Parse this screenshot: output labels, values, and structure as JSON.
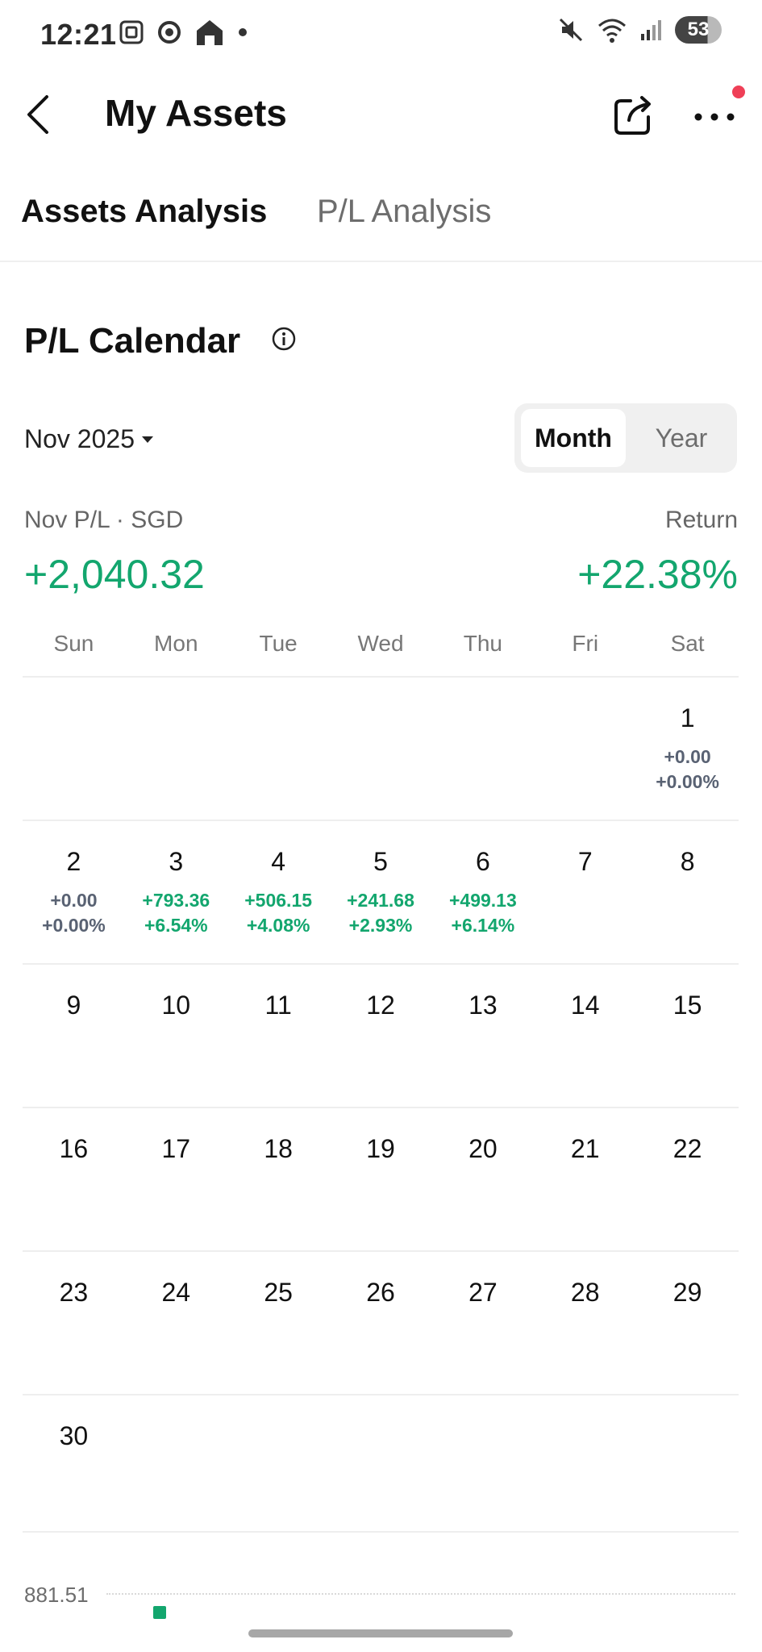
{
  "status_bar": {
    "time": "12:21",
    "battery": "53",
    "icons": [
      "scan-icon",
      "chrome-icon",
      "home-app-icon",
      "dot-icon",
      "mute-icon",
      "wifi-icon",
      "signal-icon",
      "battery-icon"
    ]
  },
  "header": {
    "title": "My Assets",
    "icons": [
      "back-arrow-icon",
      "share-icon",
      "more-icon"
    ],
    "notification_dot_color": "#ef3f57"
  },
  "tabs": [
    {
      "label": "Assets Analysis",
      "active": true
    },
    {
      "label": "P/L Analysis",
      "active": false
    }
  ],
  "section": {
    "title": "P/L Calendar",
    "info_icon": "info-icon"
  },
  "controls": {
    "month_label": "Nov 2025",
    "toggle": {
      "month": "Month",
      "year": "Year",
      "selected": "Month"
    }
  },
  "summary": {
    "pl_label": "Nov P/L · SGD",
    "pl_value": "+2,040.32",
    "return_label": "Return",
    "return_value": "+22.38%",
    "accent_color": "#13a66e"
  },
  "calendar": {
    "weekdays": [
      "Sun",
      "Mon",
      "Tue",
      "Wed",
      "Thu",
      "Fri",
      "Sat"
    ],
    "weeks": [
      [
        {
          "day": ""
        },
        {
          "day": ""
        },
        {
          "day": ""
        },
        {
          "day": ""
        },
        {
          "day": ""
        },
        {
          "day": ""
        },
        {
          "day": "1",
          "pl": "+0.00",
          "ret": "+0.00%",
          "tone": "neutral"
        }
      ],
      [
        {
          "day": "2",
          "pl": "+0.00",
          "ret": "+0.00%",
          "tone": "neutral"
        },
        {
          "day": "3",
          "pl": "+793.36",
          "ret": "+6.54%",
          "tone": "pos"
        },
        {
          "day": "4",
          "pl": "+506.15",
          "ret": "+4.08%",
          "tone": "pos"
        },
        {
          "day": "5",
          "pl": "+241.68",
          "ret": "+2.93%",
          "tone": "pos"
        },
        {
          "day": "6",
          "pl": "+499.13",
          "ret": "+6.14%",
          "tone": "pos"
        },
        {
          "day": "7"
        },
        {
          "day": "8"
        }
      ],
      [
        {
          "day": "9"
        },
        {
          "day": "10"
        },
        {
          "day": "11"
        },
        {
          "day": "12"
        },
        {
          "day": "13"
        },
        {
          "day": "14"
        },
        {
          "day": "15"
        }
      ],
      [
        {
          "day": "16"
        },
        {
          "day": "17"
        },
        {
          "day": "18"
        },
        {
          "day": "19"
        },
        {
          "day": "20"
        },
        {
          "day": "21"
        },
        {
          "day": "22"
        }
      ],
      [
        {
          "day": "23"
        },
        {
          "day": "24"
        },
        {
          "day": "25"
        },
        {
          "day": "26"
        },
        {
          "day": "27"
        },
        {
          "day": "28"
        },
        {
          "day": "29"
        }
      ],
      [
        {
          "day": "30"
        },
        {
          "day": ""
        },
        {
          "day": ""
        },
        {
          "day": ""
        },
        {
          "day": ""
        },
        {
          "day": ""
        },
        {
          "day": ""
        }
      ]
    ]
  },
  "chart_peek": {
    "label": "881.51"
  }
}
